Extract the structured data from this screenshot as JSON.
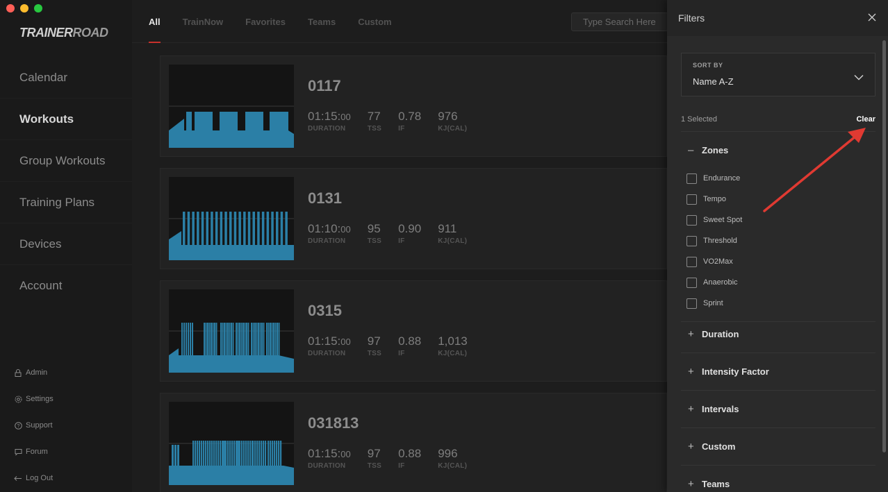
{
  "app": {
    "logo_a": "TRAINER",
    "logo_b": "ROAD"
  },
  "sidebar": {
    "items": [
      {
        "label": "Calendar",
        "active": false
      },
      {
        "label": "Workouts",
        "active": true
      },
      {
        "label": "Group Workouts",
        "active": false
      },
      {
        "label": "Training Plans",
        "active": false
      },
      {
        "label": "Devices",
        "active": false
      },
      {
        "label": "Account",
        "active": false
      }
    ],
    "bottom": [
      {
        "label": "Admin",
        "icon": "lock-icon"
      },
      {
        "label": "Settings",
        "icon": "gear-icon"
      },
      {
        "label": "Support",
        "icon": "help-icon"
      },
      {
        "label": "Forum",
        "icon": "chat-icon"
      },
      {
        "label": "Log Out",
        "icon": "logout-arrow-icon"
      }
    ]
  },
  "tabs": [
    {
      "label": "All",
      "active": true
    },
    {
      "label": "TrainNow",
      "active": false
    },
    {
      "label": "Favorites",
      "active": false
    },
    {
      "label": "Teams",
      "active": false
    },
    {
      "label": "Custom",
      "active": false
    }
  ],
  "search": {
    "placeholder": "Type Search Here"
  },
  "metric_labels": {
    "duration": "DURATION",
    "tss": "TSS",
    "if": "IF",
    "kj": "KJ(CAL)"
  },
  "workouts": [
    {
      "name": "0117",
      "duration_main": "01:15:",
      "duration_sec": "00",
      "tss": "77",
      "if": "0.78",
      "kj": "976"
    },
    {
      "name": "0131",
      "duration_main": "01:10:",
      "duration_sec": "00",
      "tss": "95",
      "if": "0.90",
      "kj": "911"
    },
    {
      "name": "0315",
      "duration_main": "01:15:",
      "duration_sec": "00",
      "tss": "97",
      "if": "0.88",
      "kj": "1,013"
    },
    {
      "name": "031813",
      "duration_main": "01:15:",
      "duration_sec": "00",
      "tss": "97",
      "if": "0.88",
      "kj": "996"
    }
  ],
  "filters": {
    "title": "Filters",
    "sort_label": "SORT BY",
    "sort_value": "Name A-Z",
    "selected_text": "1 Selected",
    "clear_label": "Clear",
    "zones_title": "Zones",
    "zones": [
      "Endurance",
      "Tempo",
      "Sweet Spot",
      "Threshold",
      "VO2Max",
      "Anaerobic",
      "Sprint"
    ],
    "sections": [
      "Duration",
      "Intensity Factor",
      "Intervals",
      "Custom",
      "Teams"
    ]
  },
  "colors": {
    "accent_red": "#c8312c",
    "chart_blue": "#2b7fa6",
    "arrow_red": "#e03a32"
  }
}
